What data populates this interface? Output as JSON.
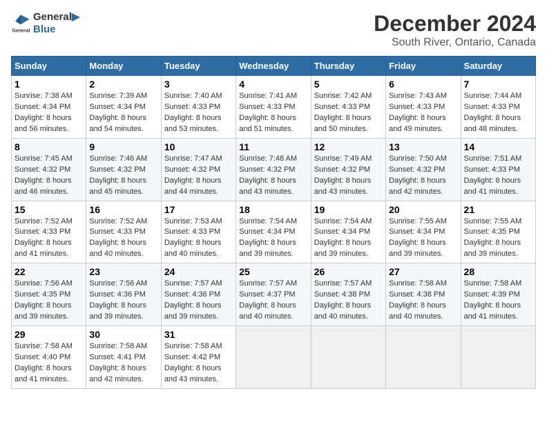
{
  "logo": {
    "line1": "General",
    "line2": "Blue"
  },
  "title": "December 2024",
  "subtitle": "South River, Ontario, Canada",
  "days_of_week": [
    "Sunday",
    "Monday",
    "Tuesday",
    "Wednesday",
    "Thursday",
    "Friday",
    "Saturday"
  ],
  "weeks": [
    [
      {
        "day": 1,
        "sunrise": "7:38 AM",
        "sunset": "4:34 PM",
        "daylight": "8 hours and 56 minutes."
      },
      {
        "day": 2,
        "sunrise": "7:39 AM",
        "sunset": "4:34 PM",
        "daylight": "8 hours and 54 minutes."
      },
      {
        "day": 3,
        "sunrise": "7:40 AM",
        "sunset": "4:33 PM",
        "daylight": "8 hours and 53 minutes."
      },
      {
        "day": 4,
        "sunrise": "7:41 AM",
        "sunset": "4:33 PM",
        "daylight": "8 hours and 51 minutes."
      },
      {
        "day": 5,
        "sunrise": "7:42 AM",
        "sunset": "4:33 PM",
        "daylight": "8 hours and 50 minutes."
      },
      {
        "day": 6,
        "sunrise": "7:43 AM",
        "sunset": "4:33 PM",
        "daylight": "8 hours and 49 minutes."
      },
      {
        "day": 7,
        "sunrise": "7:44 AM",
        "sunset": "4:33 PM",
        "daylight": "8 hours and 48 minutes."
      }
    ],
    [
      {
        "day": 8,
        "sunrise": "7:45 AM",
        "sunset": "4:32 PM",
        "daylight": "8 hours and 46 minutes."
      },
      {
        "day": 9,
        "sunrise": "7:46 AM",
        "sunset": "4:32 PM",
        "daylight": "8 hours and 45 minutes."
      },
      {
        "day": 10,
        "sunrise": "7:47 AM",
        "sunset": "4:32 PM",
        "daylight": "8 hours and 44 minutes."
      },
      {
        "day": 11,
        "sunrise": "7:48 AM",
        "sunset": "4:32 PM",
        "daylight": "8 hours and 43 minutes."
      },
      {
        "day": 12,
        "sunrise": "7:49 AM",
        "sunset": "4:32 PM",
        "daylight": "8 hours and 43 minutes."
      },
      {
        "day": 13,
        "sunrise": "7:50 AM",
        "sunset": "4:32 PM",
        "daylight": "8 hours and 42 minutes."
      },
      {
        "day": 14,
        "sunrise": "7:51 AM",
        "sunset": "4:33 PM",
        "daylight": "8 hours and 41 minutes."
      }
    ],
    [
      {
        "day": 15,
        "sunrise": "7:52 AM",
        "sunset": "4:33 PM",
        "daylight": "8 hours and 41 minutes."
      },
      {
        "day": 16,
        "sunrise": "7:52 AM",
        "sunset": "4:33 PM",
        "daylight": "8 hours and 40 minutes."
      },
      {
        "day": 17,
        "sunrise": "7:53 AM",
        "sunset": "4:33 PM",
        "daylight": "8 hours and 40 minutes."
      },
      {
        "day": 18,
        "sunrise": "7:54 AM",
        "sunset": "4:34 PM",
        "daylight": "8 hours and 39 minutes."
      },
      {
        "day": 19,
        "sunrise": "7:54 AM",
        "sunset": "4:34 PM",
        "daylight": "8 hours and 39 minutes."
      },
      {
        "day": 20,
        "sunrise": "7:55 AM",
        "sunset": "4:34 PM",
        "daylight": "8 hours and 39 minutes."
      },
      {
        "day": 21,
        "sunrise": "7:55 AM",
        "sunset": "4:35 PM",
        "daylight": "8 hours and 39 minutes."
      }
    ],
    [
      {
        "day": 22,
        "sunrise": "7:56 AM",
        "sunset": "4:35 PM",
        "daylight": "8 hours and 39 minutes."
      },
      {
        "day": 23,
        "sunrise": "7:56 AM",
        "sunset": "4:36 PM",
        "daylight": "8 hours and 39 minutes."
      },
      {
        "day": 24,
        "sunrise": "7:57 AM",
        "sunset": "4:36 PM",
        "daylight": "8 hours and 39 minutes."
      },
      {
        "day": 25,
        "sunrise": "7:57 AM",
        "sunset": "4:37 PM",
        "daylight": "8 hours and 40 minutes."
      },
      {
        "day": 26,
        "sunrise": "7:57 AM",
        "sunset": "4:38 PM",
        "daylight": "8 hours and 40 minutes."
      },
      {
        "day": 27,
        "sunrise": "7:58 AM",
        "sunset": "4:38 PM",
        "daylight": "8 hours and 40 minutes."
      },
      {
        "day": 28,
        "sunrise": "7:58 AM",
        "sunset": "4:39 PM",
        "daylight": "8 hours and 41 minutes."
      }
    ],
    [
      {
        "day": 29,
        "sunrise": "7:58 AM",
        "sunset": "4:40 PM",
        "daylight": "8 hours and 41 minutes."
      },
      {
        "day": 30,
        "sunrise": "7:58 AM",
        "sunset": "4:41 PM",
        "daylight": "8 hours and 42 minutes."
      },
      {
        "day": 31,
        "sunrise": "7:58 AM",
        "sunset": "4:42 PM",
        "daylight": "8 hours and 43 minutes."
      },
      null,
      null,
      null,
      null
    ]
  ]
}
